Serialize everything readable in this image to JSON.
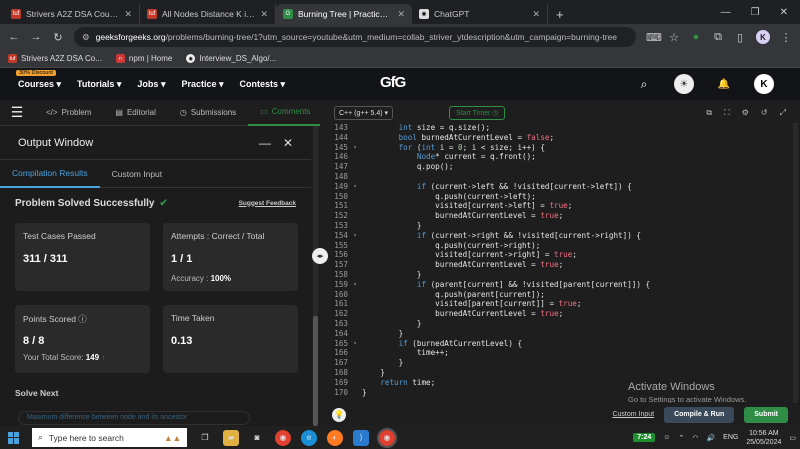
{
  "browser": {
    "tabs": [
      {
        "label": "Strivers A2Z DSA Course/Sheet",
        "icon": "tuf-favicon"
      },
      {
        "label": "All Nodes Distance K in Binary T",
        "icon": "tuf-favicon"
      },
      {
        "label": "Burning Tree | Practice | GeeksfS",
        "icon": "gfg-favicon"
      },
      {
        "label": "ChatGPT",
        "icon": "chatgpt-favicon"
      }
    ],
    "url_host": "geeksforgeeks.org",
    "url_path": "/problems/burning-tree/1?utm_source=youtube&utm_medium=collab_striver_ytdescription&utm_campaign=burning-tree",
    "profile_letter": "K",
    "bookmarks": [
      "Strivers A2Z DSA Co...",
      "npm | Home",
      "Interview_DS_Algo/..."
    ]
  },
  "gfg_nav": {
    "badge": "30% Discount",
    "items": [
      "Courses",
      "Tutorials",
      "Jobs",
      "Practice",
      "Contests"
    ],
    "logo": "GfG",
    "avatar_letter": "K"
  },
  "problem_tabs": [
    "Problem",
    "Editorial",
    "Submissions",
    "Comments"
  ],
  "output": {
    "title": "Output Window",
    "tabs": [
      "Compilation Results",
      "Custom Input"
    ],
    "status": "Problem Solved Successfully",
    "feedback": "Suggest Feedback",
    "test_cases_title": "Test Cases Passed",
    "test_cases_value": "311 / 311",
    "attempts_title": "Attempts : Correct / Total",
    "attempts_value": "1 / 1",
    "accuracy_label": "Accuracy :",
    "accuracy_value": "100%",
    "points_title": "Points Scored",
    "points_value": "8 / 8",
    "total_score_label": "Your Total Score:",
    "total_score_value": "149",
    "time_title": "Time Taken",
    "time_value": "0.13",
    "solve_next": "Solve Next",
    "next_problem": "Maximum difference between node and its ancestor"
  },
  "editor": {
    "language": "C++ (g++ 5.4)",
    "timer": "Start Timer",
    "lines": [
      {
        "n": "143",
        "fold": "",
        "code": "        int size = q.size();"
      },
      {
        "n": "144",
        "fold": "",
        "code": "        bool burnedAtCurrentLevel = false;"
      },
      {
        "n": "145",
        "fold": "▾",
        "code": "        for (int i = 0; i < size; i++) {"
      },
      {
        "n": "146",
        "fold": "",
        "code": "            Node* current = q.front();"
      },
      {
        "n": "147",
        "fold": "",
        "code": "            q.pop();"
      },
      {
        "n": "148",
        "fold": "",
        "code": ""
      },
      {
        "n": "149",
        "fold": "▾",
        "code": "            if (current->left && !visited[current->left]) {"
      },
      {
        "n": "150",
        "fold": "",
        "code": "                q.push(current->left);"
      },
      {
        "n": "151",
        "fold": "",
        "code": "                visited[current->left] = true;"
      },
      {
        "n": "152",
        "fold": "",
        "code": "                burnedAtCurrentLevel = true;"
      },
      {
        "n": "153",
        "fold": "",
        "code": "            }"
      },
      {
        "n": "154",
        "fold": "▾",
        "code": "            if (current->right && !visited[current->right]) {"
      },
      {
        "n": "155",
        "fold": "",
        "code": "                q.push(current->right);"
      },
      {
        "n": "156",
        "fold": "",
        "code": "                visited[current->right] = true;"
      },
      {
        "n": "157",
        "fold": "",
        "code": "                burnedAtCurrentLevel = true;"
      },
      {
        "n": "158",
        "fold": "",
        "code": "            }"
      },
      {
        "n": "159",
        "fold": "▾",
        "code": "            if (parent[current] && !visited[parent[current]]) {"
      },
      {
        "n": "160",
        "fold": "",
        "code": "                q.push(parent[current]);"
      },
      {
        "n": "161",
        "fold": "",
        "code": "                visited[parent[current]] = true;"
      },
      {
        "n": "162",
        "fold": "",
        "code": "                burnedAtCurrentLevel = true;"
      },
      {
        "n": "163",
        "fold": "",
        "code": "            }"
      },
      {
        "n": "164",
        "fold": "",
        "code": "        }"
      },
      {
        "n": "165",
        "fold": "▾",
        "code": "        if (burnedAtCurrentLevel) {"
      },
      {
        "n": "166",
        "fold": "",
        "code": "            time++;"
      },
      {
        "n": "167",
        "fold": "",
        "code": "        }"
      },
      {
        "n": "168",
        "fold": "",
        "code": "    }"
      },
      {
        "n": "169",
        "fold": "",
        "code": "    return time;"
      },
      {
        "n": "170",
        "fold": "",
        "code": "}"
      }
    ],
    "custom_input": "Custom Input",
    "compile_run": "Compile & Run",
    "submit": "Submit"
  },
  "watermark": {
    "line1": "Activate Windows",
    "line2": "Go to Settings to activate Windows."
  },
  "taskbar": {
    "search_placeholder": "Type here to search",
    "time_badge": "7:24",
    "lang": "ENG",
    "time": "10:56 AM",
    "date": "25/05/2024"
  },
  "colors": {
    "gfg_green": "#2f8d46",
    "link_blue": "#4aa3df",
    "submit_green": "#2f8d46"
  }
}
